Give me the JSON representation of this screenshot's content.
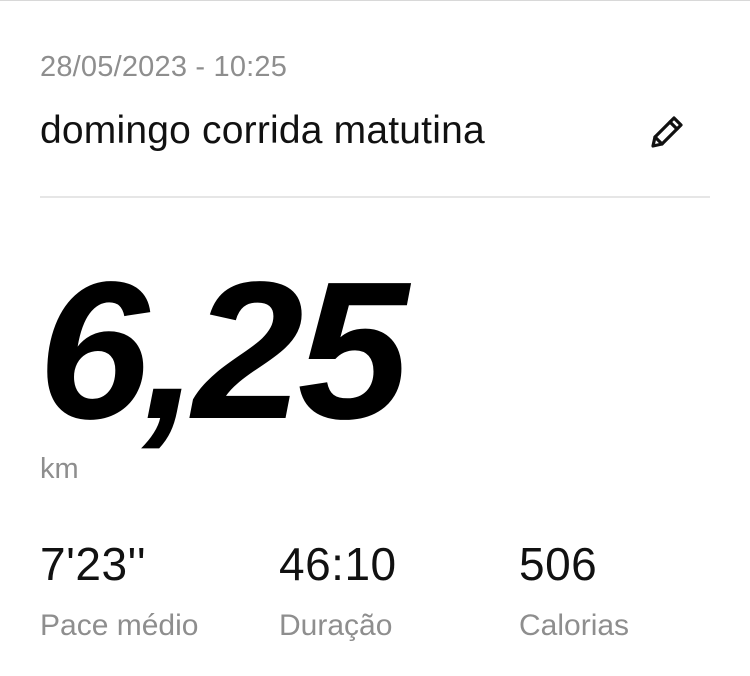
{
  "activity": {
    "datetime": "28/05/2023 - 10:25",
    "title": "domingo corrida matutina",
    "edit_icon": "pencil-icon"
  },
  "summary": {
    "distance": "6,25",
    "unit": "km"
  },
  "stats": [
    {
      "value": "7'23''",
      "label": "Pace médio"
    },
    {
      "value": "46:10",
      "label": "Duração"
    },
    {
      "value": "506",
      "label": "Calorias"
    }
  ]
}
